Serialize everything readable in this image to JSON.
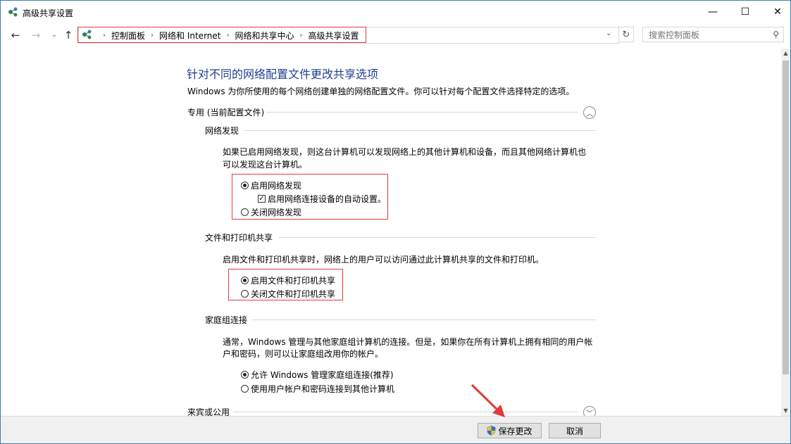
{
  "window": {
    "title": "高级共享设置",
    "minimize_glyph": "—",
    "maximize_glyph": "☐",
    "close_glyph": "✕"
  },
  "nav": {
    "back_glyph": "←",
    "forward_glyph": "→",
    "recent_glyph": "⌄",
    "up_glyph": "↑",
    "breadcrumbs": [
      "控制面板",
      "网络和 Internet",
      "网络和共享中心",
      "高级共享设置"
    ],
    "separator": "›",
    "dropdown_glyph": "⌄",
    "refresh_glyph": "↻",
    "search_placeholder": "搜索控制面板",
    "search_glyph": "⚲"
  },
  "main": {
    "heading": "针对不同的网络配置文件更改共享选项",
    "description": "Windows 为你所使用的每个网络创建单独的网络配置文件。你可以针对每个配置文件选择特定的选项。",
    "private_profile": {
      "title": "专用 (当前配置文件)",
      "collapse_glyph": "︿",
      "network_discovery": {
        "title": "网络发现",
        "desc_line1": "如果已启用网络发现，则这台计算机可以发现网络上的其他计算机和设备，而且其他网络计算机也",
        "desc_line2": "可以发现这台计算机。",
        "enable_label": "启用网络发现",
        "auto_setup_label": "启用网络连接设备的自动设置。",
        "disable_label": "关闭网络发现",
        "check_glyph": "✓"
      },
      "file_printer_sharing": {
        "title": "文件和打印机共享",
        "desc": "启用文件和打印机共享时，网络上的用户可以访问通过此计算机共享的文件和打印机。",
        "enable_label": "启用文件和打印机共享",
        "disable_label": "关闭文件和打印机共享"
      },
      "homegroup": {
        "title": "家庭组连接",
        "desc_line1": "通常，Windows 管理与其他家庭组计算机的连接。但是，如果你在所有计算机上拥有相同的用户帐",
        "desc_line2": "户和密码，则可以让家庭组改用你的帐户。",
        "allow_label": "允许 Windows 管理家庭组连接(推荐)",
        "use_account_label": "使用用户帐户和密码连接到其他计算机"
      }
    },
    "guest_profile": {
      "title": "来宾或公用",
      "expand_glyph": "﹀"
    }
  },
  "scrollbar": {
    "up_glyph": "▲",
    "down_glyph": "▼"
  },
  "footer": {
    "save_label": "保存更改",
    "cancel_label": "取消"
  },
  "colors": {
    "heading": "#1e3f8f",
    "highlight_box": "#e03b3b",
    "annotation_arrow": "#e03b3b"
  }
}
